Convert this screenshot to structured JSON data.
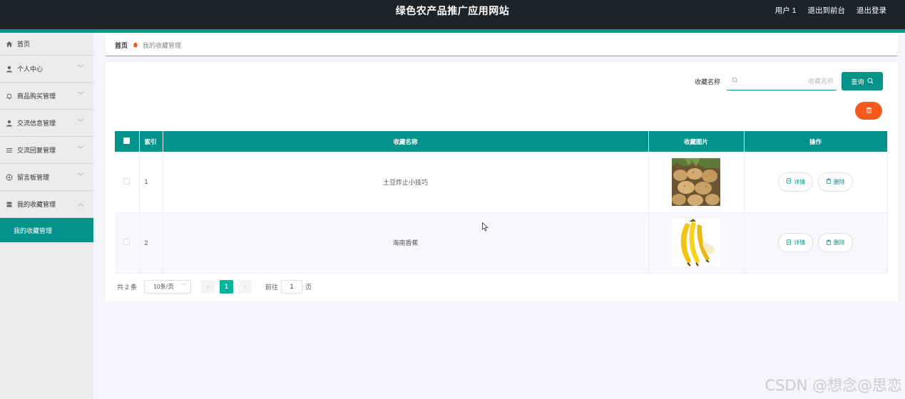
{
  "header": {
    "title": "绿色农产品推广应用网站",
    "user": "用户 1",
    "back_to_front": "退出到前台",
    "logout": "退出登录"
  },
  "sidebar": {
    "items": [
      {
        "label": "首页",
        "icon": "home-icon"
      },
      {
        "label": "个人中心",
        "icon": "user-icon"
      },
      {
        "label": "商品购买管理",
        "icon": "bell-icon"
      },
      {
        "label": "交流信息管理",
        "icon": "user-icon"
      },
      {
        "label": "交流回复管理",
        "icon": "list-icon"
      },
      {
        "label": "留言板管理",
        "icon": "dial-icon"
      },
      {
        "label": "我的收藏管理",
        "icon": "stack-icon"
      }
    ],
    "active_sub": "我的收藏管理"
  },
  "breadcrumb": {
    "home": "首页",
    "current": "我的收藏管理"
  },
  "search": {
    "label": "收藏名称",
    "placeholder": "收藏名称",
    "button": "查询"
  },
  "table": {
    "headers": {
      "index": "索引",
      "name": "收藏名称",
      "image": "收藏图片",
      "actions": "操作"
    },
    "rows": [
      {
        "index": "1",
        "name": "土豆炸止小技巧",
        "image": "potatoes"
      },
      {
        "index": "2",
        "name": "海南香蕉",
        "image": "bananas"
      }
    ],
    "detail_label": "详情",
    "delete_label": "删除"
  },
  "pagination": {
    "total": "共 2 条",
    "page_size": "10条/页",
    "current_page": "1",
    "goto_label": "前往",
    "goto_value": "1",
    "goto_suffix": "页"
  },
  "watermark": "CSDN @想念@思恋",
  "colors": {
    "accent": "#03938a",
    "danger": "#f4591d",
    "header_bg": "#1f2326"
  }
}
